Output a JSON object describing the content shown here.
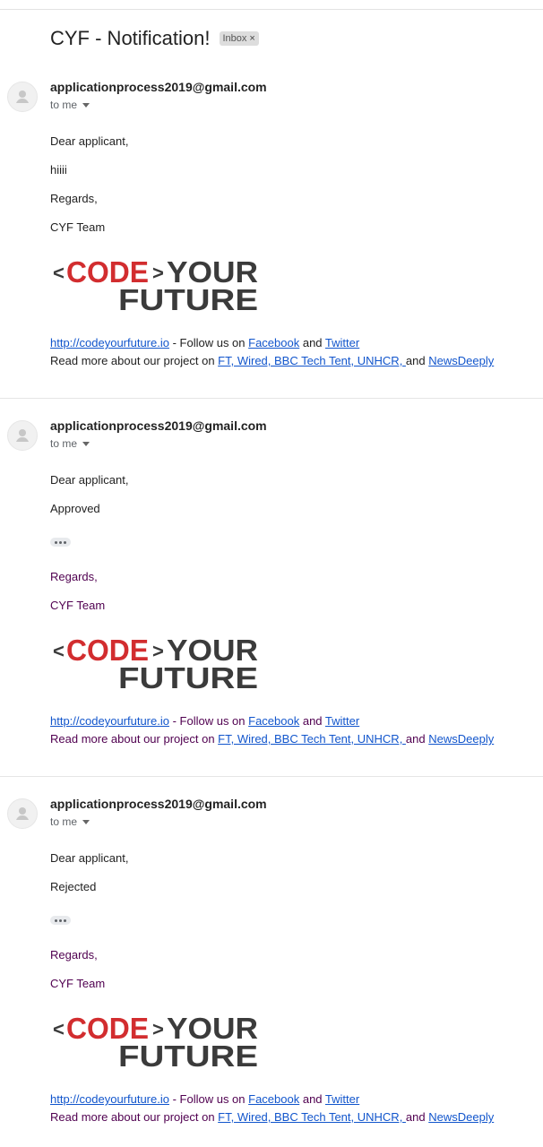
{
  "subject": "CYF - Notification!",
  "label": {
    "text": "Inbox",
    "close": "×"
  },
  "messages": [
    {
      "sender": "applicationprocess2019@gmail.com",
      "to": "to me",
      "greeting": "Dear applicant,",
      "body": "hiiii",
      "regards": "Regards,",
      "team": "CYF Team",
      "link": "http://codeyourfuture.io",
      "follow": " - Follow us on ",
      "facebook": "Facebook",
      "and1": " and ",
      "twitter": "Twitter",
      "readmore": "Read more about our project on ",
      "press": "FT, Wired, BBC Tech Tent, UNHCR, ",
      "and2": "and ",
      "newsdeeply": "NewsDeeply"
    },
    {
      "sender": "applicationprocess2019@gmail.com",
      "to": "to me",
      "greeting": "Dear applicant,",
      "body": "Approved",
      "regards": "Regards,",
      "team": "CYF Team",
      "link": "http://codeyourfuture.io",
      "follow": " - Follow us on ",
      "facebook": "Facebook",
      "and1": " and ",
      "twitter": "Twitter",
      "readmore": "Read more about our project on ",
      "press": "FT, Wired, BBC Tech Tent, UNHCR, ",
      "and2": "and ",
      "newsdeeply": "NewsDeeply"
    },
    {
      "sender": "applicationprocess2019@gmail.com",
      "to": "to me",
      "greeting": "Dear applicant,",
      "body": "Rejected",
      "regards": "Regards,",
      "team": "CYF Team",
      "link": "http://codeyourfuture.io",
      "follow": " - Follow us on ",
      "facebook": "Facebook",
      "and1": " and ",
      "twitter": "Twitter",
      "readmore": "Read more about our project on ",
      "press": "FT, Wired, BBC Tech Tent, UNHCR, ",
      "and2": "and ",
      "newsdeeply": "NewsDeeply"
    }
  ],
  "logo": {
    "lt": "<",
    "code": "CODE",
    "gt": ">",
    "your": "YOUR",
    "future": "FUTURE"
  },
  "colors": {
    "logo_red": "#d22d2f",
    "logo_dark": "#3b3b3b",
    "link": "#1155cc",
    "quoted": "#500050"
  }
}
